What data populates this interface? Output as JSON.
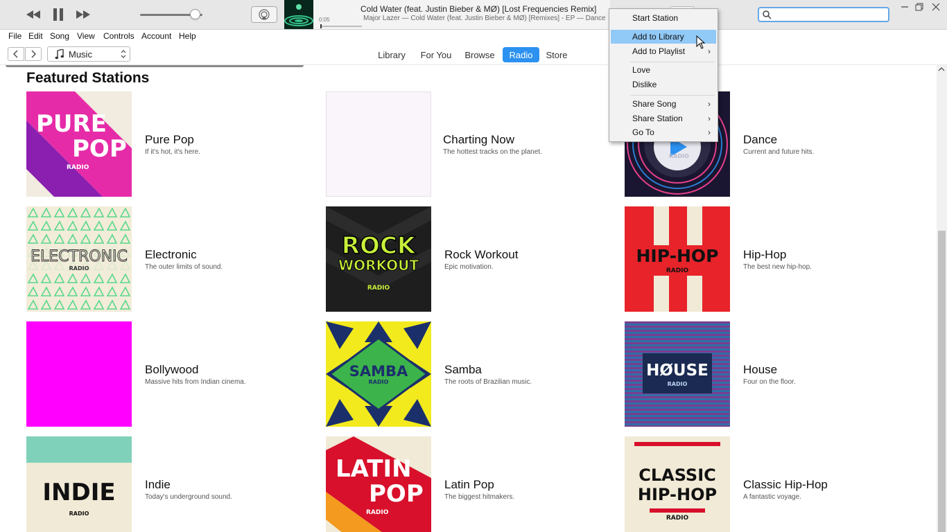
{
  "player": {
    "song_title": "Cold Water (feat. Justin Bieber & MØ) [Lost Frequencies Remix]",
    "song_subtitle": "Major Lazer — Cold Water (feat. Justin Bieber & MØ) [Remixes] - EP — Dance",
    "elapsed": "0:05",
    "volume": 0.88,
    "search_placeholder": ""
  },
  "menubar": [
    "File",
    "Edit",
    "Song",
    "View",
    "Controls",
    "Account",
    "Help"
  ],
  "nav": {
    "media_kind": "Music",
    "tabs": [
      {
        "label": "Library",
        "active": false
      },
      {
        "label": "For You",
        "active": false
      },
      {
        "label": "Browse",
        "active": false
      },
      {
        "label": "Radio",
        "active": true
      },
      {
        "label": "Store",
        "active": false
      }
    ]
  },
  "section_title": "Featured Stations",
  "stations": [
    {
      "name": "Pure Pop",
      "desc": "If it's hot, it's here.",
      "cover_text": [
        "PURE",
        "POP",
        "RADIO"
      ]
    },
    {
      "name": "Charting Now",
      "desc": "The hottest tracks on the planet.",
      "cover_text": []
    },
    {
      "name": "Dance",
      "desc": "Current and future hits.",
      "cover_text": [
        "RADIO"
      ]
    },
    {
      "name": "Electronic",
      "desc": "The outer limits of sound.",
      "cover_text": [
        "ELECTRONIC",
        "RADIO"
      ]
    },
    {
      "name": "Rock Workout",
      "desc": "Epic motivation.",
      "cover_text": [
        "ROCK",
        "WORKOUT",
        "RADIO"
      ]
    },
    {
      "name": "Hip-Hop",
      "desc": "The best new hip-hop.",
      "cover_text": [
        "HIP-HOP",
        "RADIO"
      ]
    },
    {
      "name": "Bollywood",
      "desc": "Massive hits from Indian cinema.",
      "cover_text": []
    },
    {
      "name": "Samba",
      "desc": "The roots of Brazilian music.",
      "cover_text": [
        "SAMBA",
        "RADIO"
      ]
    },
    {
      "name": "House",
      "desc": "Four on the floor.",
      "cover_text": [
        "HØUSE",
        "RADIO"
      ]
    },
    {
      "name": "Indie",
      "desc": "Today's underground sound.",
      "cover_text": [
        "INDIE",
        "RADIO"
      ]
    },
    {
      "name": "Latin Pop",
      "desc": "The biggest hitmakers.",
      "cover_text": [
        "LATIN",
        "POP",
        "RADIO"
      ]
    },
    {
      "name": "Classic Hip-Hop",
      "desc": "A fantastic voyage.",
      "cover_text": [
        "CLASSIC",
        "HIP-HOP",
        "RADIO"
      ]
    }
  ],
  "context_menu": {
    "items": [
      {
        "label": "Start Station",
        "submenu": false
      },
      {
        "label": "Add to Library",
        "submenu": false,
        "highlighted": true
      },
      {
        "label": "Add to Playlist",
        "submenu": true
      },
      {
        "label": "Love",
        "submenu": false
      },
      {
        "label": "Dislike",
        "submenu": false
      },
      {
        "label": "Share Song",
        "submenu": true
      },
      {
        "label": "Share Station",
        "submenu": true
      },
      {
        "label": "Go To",
        "submenu": true
      }
    ]
  },
  "colors": {
    "accent": "#2c91f0",
    "menu_highlight": "#91c9f7",
    "pure_pop": "#e62ba8",
    "bollywood": "#ff00ff",
    "hiphop_red": "#e8232a",
    "rock_green": "#c8f03a",
    "samba_green": "#3cb44b",
    "indie_teal": "#7fd1b9",
    "house_navy": "#1b2a52",
    "latin_red": "#d8102b"
  }
}
